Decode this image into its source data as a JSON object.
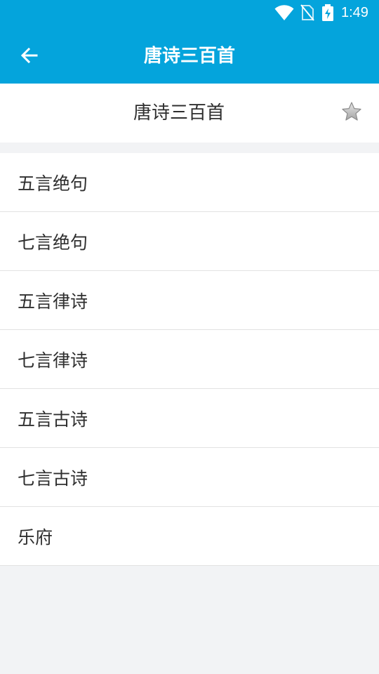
{
  "status_bar": {
    "time": "1:49",
    "icons": [
      "wifi-icon",
      "no-sim-icon",
      "battery-charging-icon"
    ]
  },
  "toolbar": {
    "title": "唐诗三百首",
    "back_icon": "arrow-left-icon"
  },
  "header": {
    "title": "唐诗三百首",
    "favorite_icon": "star-icon"
  },
  "categories": [
    {
      "label": "五言绝句"
    },
    {
      "label": "七言绝句"
    },
    {
      "label": "五言律诗"
    },
    {
      "label": "七言律诗"
    },
    {
      "label": "五言古诗"
    },
    {
      "label": "七言古诗"
    },
    {
      "label": "乐府"
    }
  ],
  "colors": {
    "app_bar": "#04a4dc",
    "background": "#f2f3f5",
    "list_background": "#ffffff",
    "text": "#2f2f2f",
    "divider": "#e2e2e2"
  }
}
